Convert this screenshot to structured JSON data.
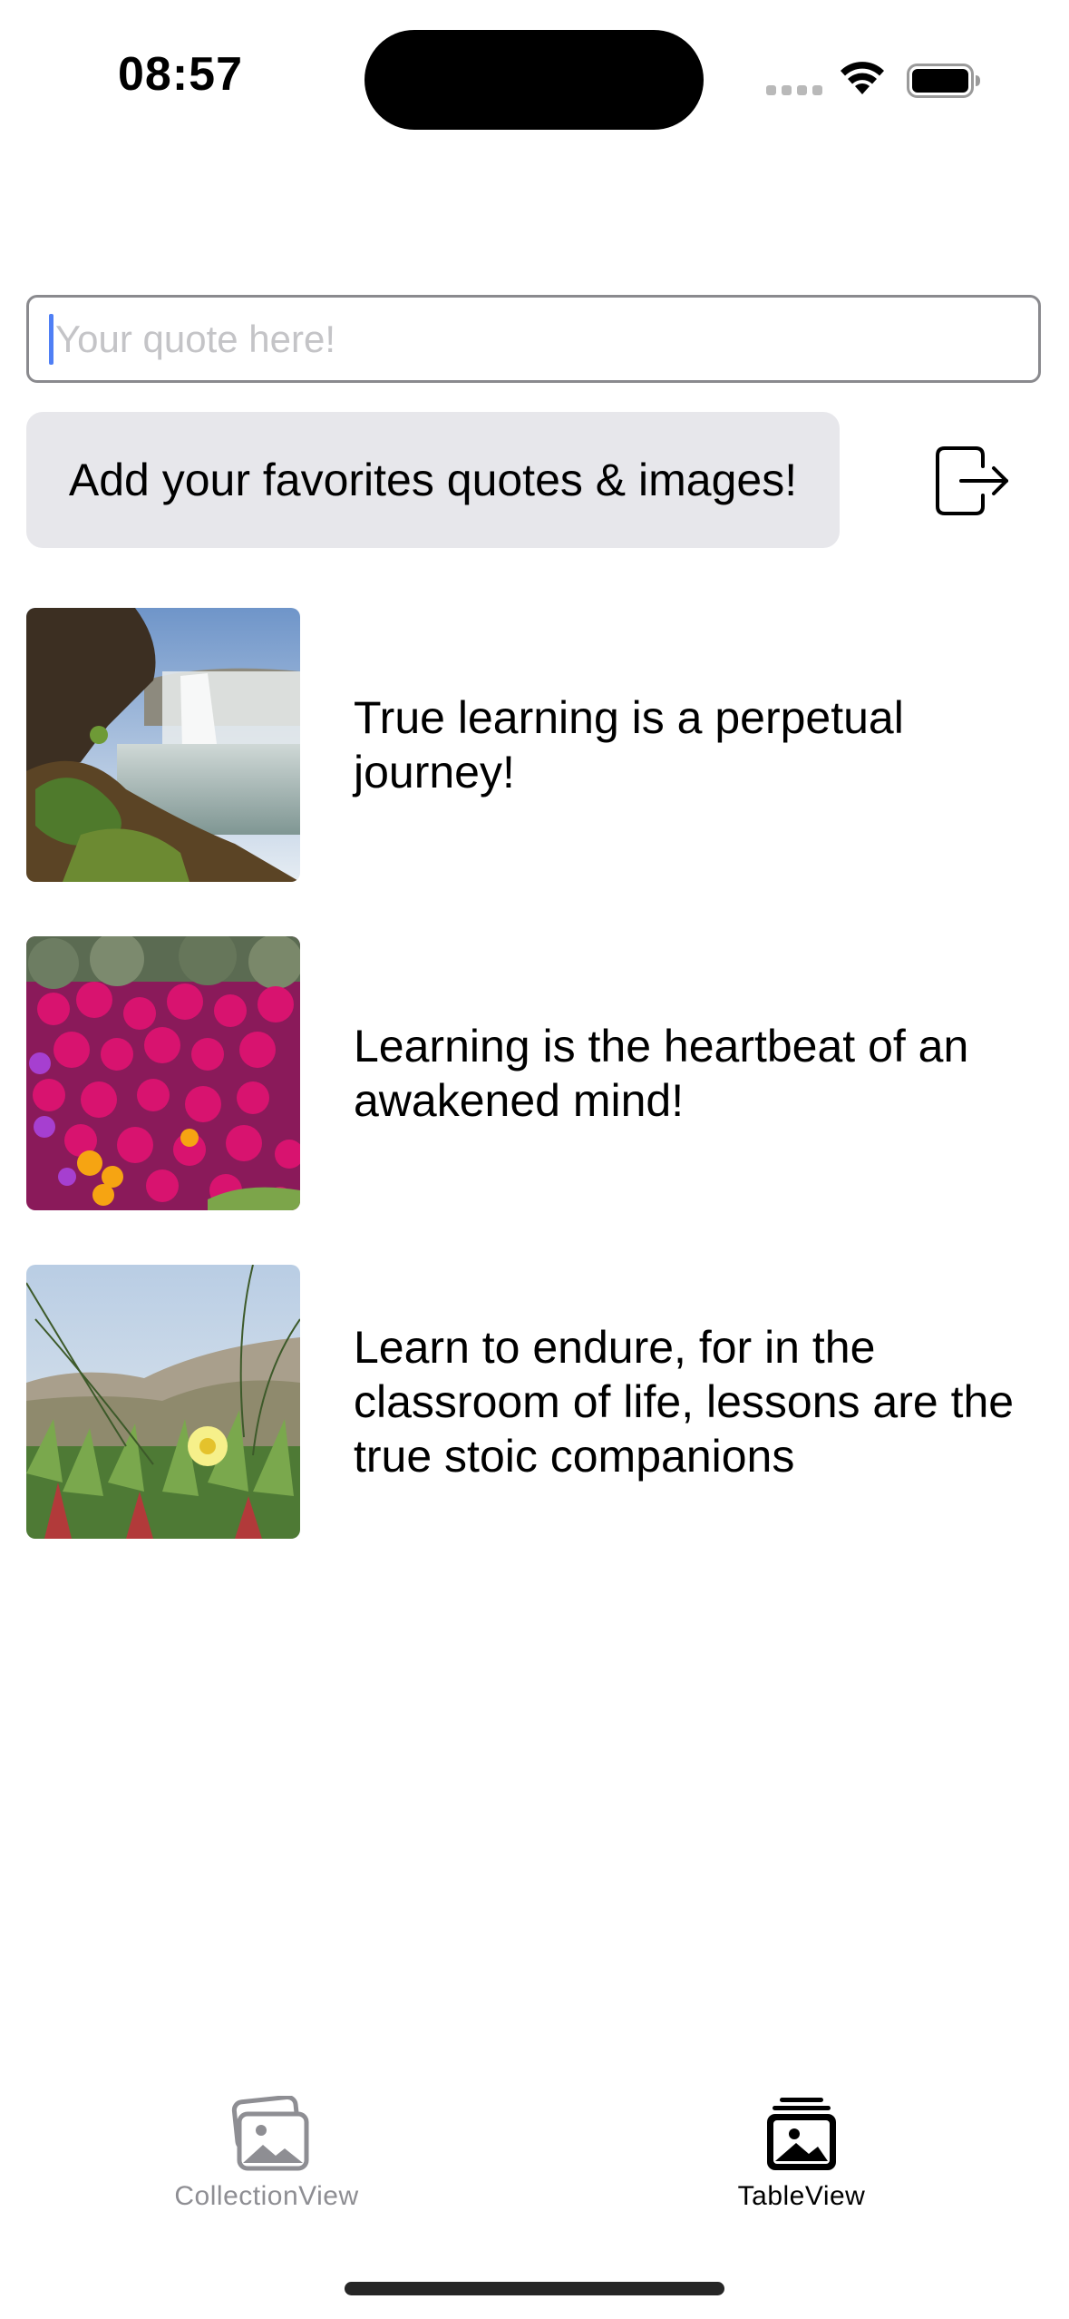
{
  "status_bar": {
    "time": "08:57"
  },
  "quote_input": {
    "placeholder": "Your quote here!",
    "value": ""
  },
  "add_button": {
    "label": "Add your favorites quotes & images!"
  },
  "logout_icon": "logout-icon",
  "list": {
    "items": [
      {
        "image": "waterfall-photo",
        "text": "True learning is a perpetual journey!"
      },
      {
        "image": "pink-flowers-photo",
        "text": "Learning is the heartbeat of an awakened mind!"
      },
      {
        "image": "yellow-flower-dunes-photo",
        "text": "Learn to endure, for in the classroom of life, lessons are the true stoic companions"
      }
    ]
  },
  "tab_bar": {
    "tabs": [
      {
        "label": "CollectionView",
        "icon": "photo-stack-icon",
        "selected": false
      },
      {
        "label": "TableView",
        "icon": "photo-stack-filled-icon",
        "selected": true
      }
    ]
  },
  "colors": {
    "caret": "#4f7ff5",
    "button_background": "#e7e7eb",
    "tab_inactive": "#8e8e93",
    "tab_active": "#000000"
  }
}
